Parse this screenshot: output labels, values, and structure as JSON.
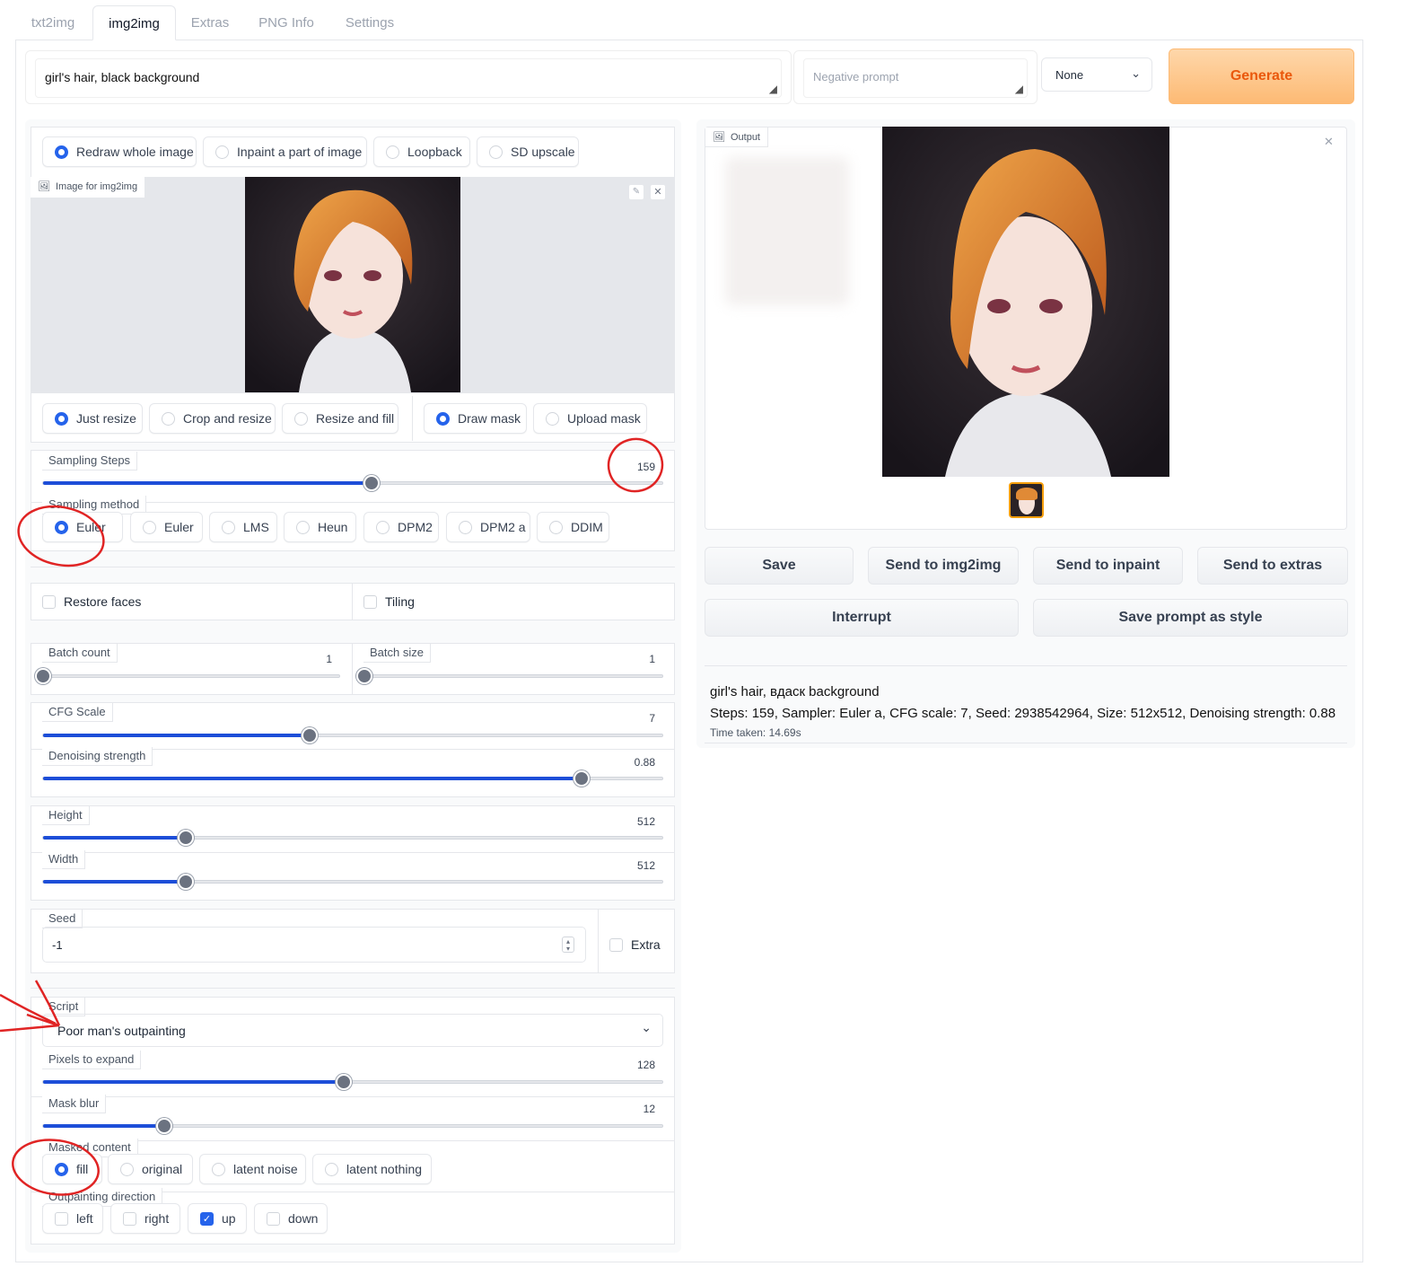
{
  "tabs": [
    "txt2img",
    "img2img",
    "Extras",
    "PNG Info",
    "Settings"
  ],
  "active_tab": "img2img",
  "prompt": {
    "value": "girl's hair, black background",
    "negative_placeholder": "Negative prompt"
  },
  "style_select": {
    "value": "None"
  },
  "generate_label": "Generate",
  "mode_radios": [
    "Redraw whole image",
    "Inpaint a part of image",
    "Loopback",
    "SD upscale"
  ],
  "image_label": "Image for img2img",
  "resize_radios": [
    "Just resize",
    "Crop and resize",
    "Resize and fill"
  ],
  "mask_radios": [
    "Draw mask",
    "Upload mask"
  ],
  "sampling_steps": {
    "label": "Sampling Steps",
    "value": "159",
    "level": 0.53
  },
  "sampling_method": {
    "label": "Sampling method",
    "options": [
      "Euler a",
      "Euler",
      "LMS",
      "Heun",
      "DPM2",
      "DPM2 a",
      "DDIM"
    ],
    "selected_display": "Euler"
  },
  "restore_faces": "Restore faces",
  "tiling": "Tiling",
  "batch_count": {
    "label": "Batch count",
    "value": "1",
    "level": 0.0
  },
  "batch_size": {
    "label": "Batch size",
    "value": "1",
    "level": 0.0
  },
  "cfg_scale": {
    "label": "CFG Scale",
    "value": "7",
    "level": 0.43
  },
  "denoising": {
    "label": "Denoising strength",
    "value": "0.88",
    "level": 0.87
  },
  "height": {
    "label": "Height",
    "value": "512",
    "level": 0.23
  },
  "width": {
    "label": "Width",
    "value": "512",
    "level": 0.23
  },
  "seed": {
    "label": "Seed",
    "value": "-1"
  },
  "extra": "Extra",
  "script": {
    "label": "Script",
    "value": "Poor man's outpainting"
  },
  "pixels_to_expand": {
    "label": "Pixels to expand",
    "value": "128",
    "level": 0.485
  },
  "mask_blur": {
    "label": "Mask blur",
    "value": "12",
    "level": 0.195
  },
  "masked_content": {
    "label": "Masked content",
    "options": [
      "fill",
      "original",
      "latent noise",
      "latent nothing"
    ]
  },
  "outpainting_direction": {
    "label": "Outpainting direction",
    "options": [
      "left",
      "right",
      "up",
      "down"
    ]
  },
  "output_label": "Output",
  "output_buttons": [
    "Save",
    "Send to img2img",
    "Send to inpaint",
    "Send to extras"
  ],
  "interrupt_label": "Interrupt",
  "save_style_label": "Save prompt as style",
  "info": {
    "prompt": "girl's hair, вдаск background",
    "params": "Steps: 159, Sampler: Euler a, CFG scale: 7, Seed: 2938542964, Size: 512x512, Denoising strength: 0.88",
    "time": "Time taken: 14.69s"
  },
  "colors": {
    "accent": "#2563eb",
    "generate_start": "#fed7aa",
    "generate_end": "#fdba74",
    "generate_text": "#ea580c",
    "annotation_red": "#e02424"
  }
}
